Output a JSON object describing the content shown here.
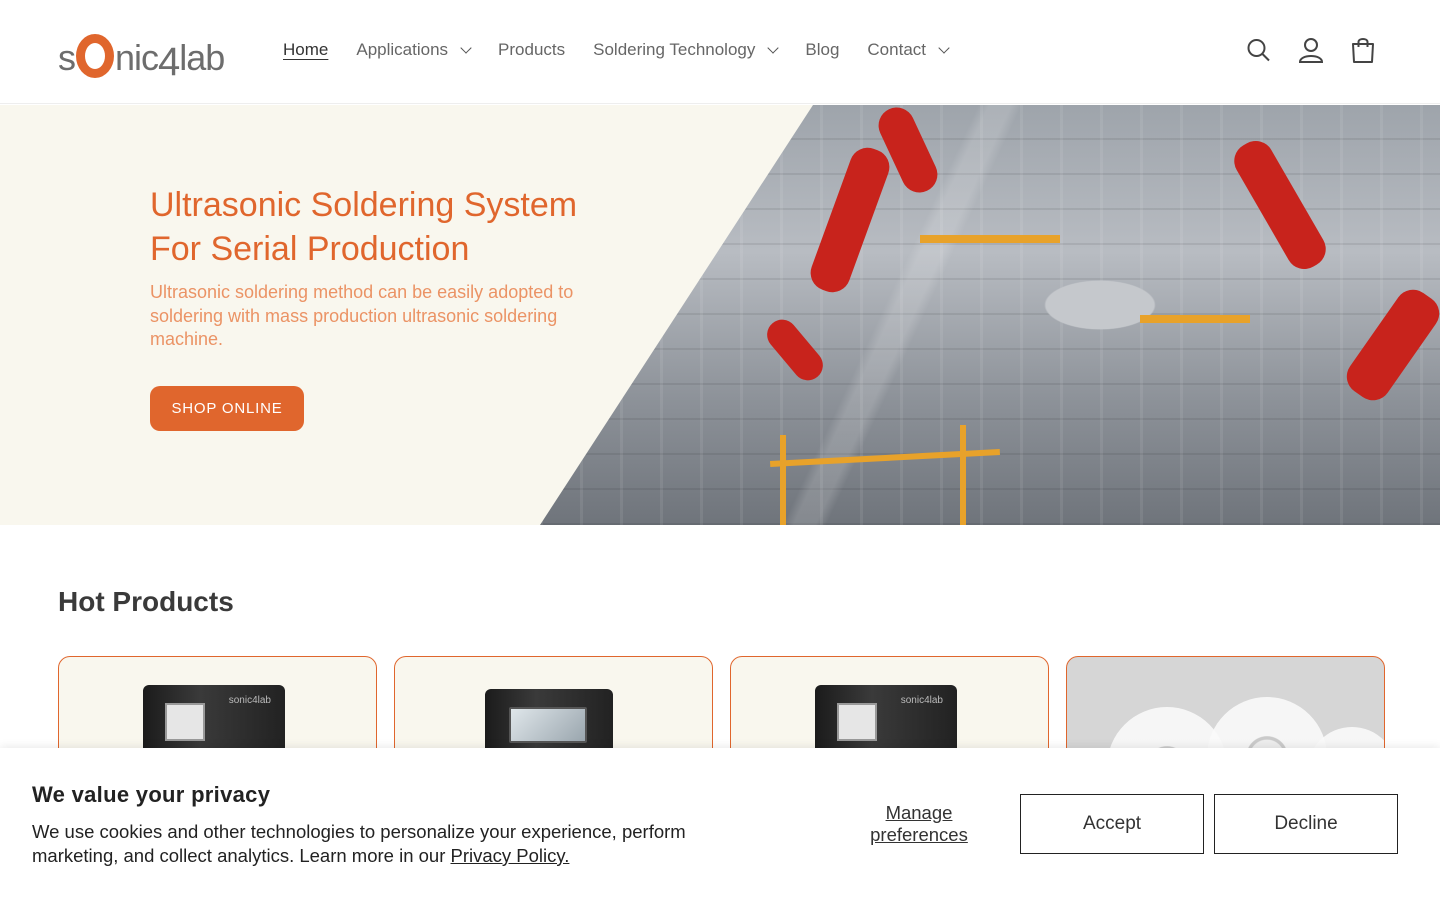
{
  "brand": {
    "logo_prefix": "s",
    "logo_suffix": "nic",
    "logo_digit": "4",
    "logo_end": "lab",
    "accent": "#e0662d"
  },
  "nav": {
    "items": [
      {
        "label": "Home",
        "active": true,
        "dropdown": false
      },
      {
        "label": "Applications",
        "active": false,
        "dropdown": true
      },
      {
        "label": "Products",
        "active": false,
        "dropdown": false
      },
      {
        "label": "Soldering Technology",
        "active": false,
        "dropdown": true
      },
      {
        "label": "Blog",
        "active": false,
        "dropdown": false
      },
      {
        "label": "Contact",
        "active": false,
        "dropdown": true
      }
    ]
  },
  "header_icons": [
    "search-icon",
    "account-icon",
    "cart-icon"
  ],
  "hero": {
    "title": "Ultrasonic Soldering System For Serial Production",
    "subtitle": "Ultrasonic soldering method can be easily adopted to soldering with mass production ultrasonic soldering machine.",
    "button": "SHOP ONLINE"
  },
  "hot_products": {
    "title": "Hot Products",
    "cards": [
      {
        "image": "controller-unit",
        "brand": "sonic4lab"
      },
      {
        "image": "touchscreen-unit",
        "brand": ""
      },
      {
        "image": "controller-unit",
        "brand": "sonic4lab"
      },
      {
        "image": "solder-wire-spools",
        "brand": ""
      }
    ]
  },
  "cookie": {
    "title": "We value your privacy",
    "text": "We use cookies and other technologies to personalize your experience, perform marketing, and collect analytics. Learn more in our ",
    "link": "Privacy Policy.",
    "manage": "Manage preferences",
    "accept": "Accept",
    "decline": "Decline"
  }
}
